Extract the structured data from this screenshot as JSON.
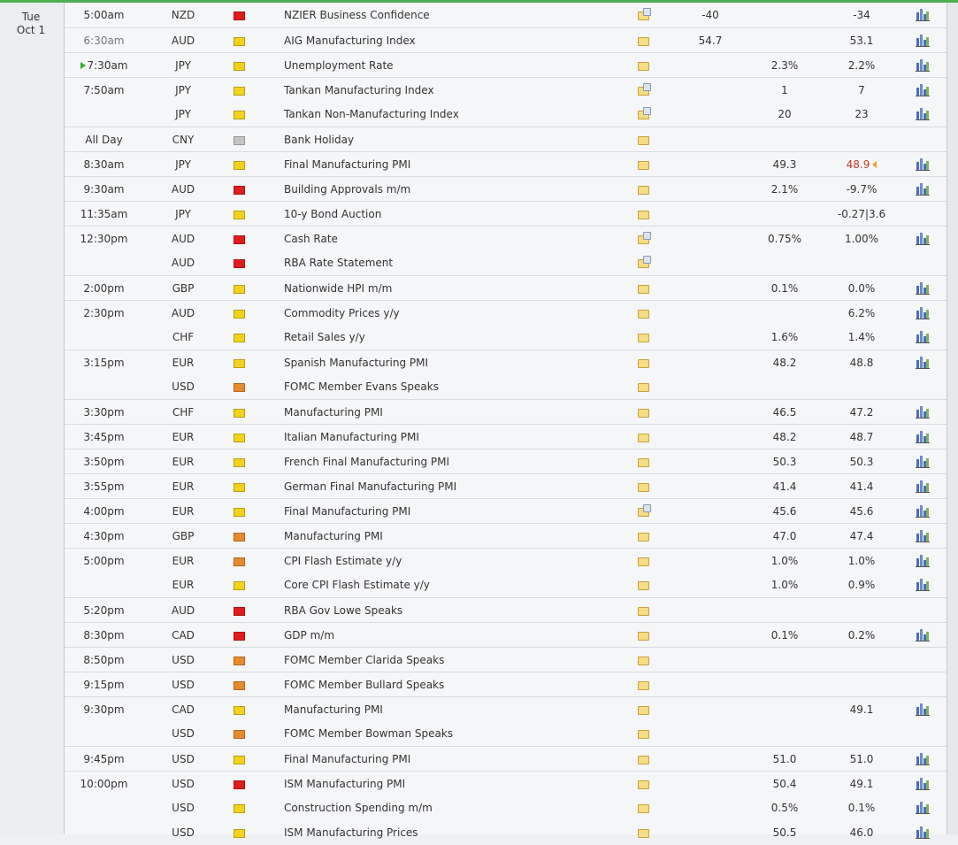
{
  "day": {
    "weekday": "Tue",
    "date": "Oct 1"
  },
  "accent_colors": {
    "high": "#e21b1b",
    "medium": "#e88a2c",
    "low": "#f4d21c",
    "holiday": "#c4c4c4",
    "revised": "#c0392b",
    "top_bar": "#4caf50"
  },
  "events": [
    {
      "time": "5:00am",
      "currency": "NZD",
      "impact": "high",
      "event": "NZIER Business Confidence",
      "detail_icon": "doc",
      "actual": "-40",
      "forecast": "",
      "previous": "-34",
      "chart": true
    },
    {
      "time": "6:30am",
      "currency": "AUD",
      "impact": "low",
      "event": "AIG Manufacturing Index",
      "detail_icon": "folder",
      "actual": "54.7",
      "forecast": "",
      "previous": "53.1",
      "chart": true
    },
    {
      "time": "7:30am",
      "currency": "JPY",
      "impact": "low",
      "event": "Unemployment Rate",
      "detail_icon": "folder",
      "actual": "",
      "forecast": "2.3%",
      "previous": "2.2%",
      "chart": true,
      "live": true
    },
    {
      "time": "7:50am",
      "currency": "JPY",
      "impact": "low",
      "event": "Tankan Manufacturing Index",
      "detail_icon": "doc",
      "actual": "",
      "forecast": "1",
      "previous": "7",
      "chart": true
    },
    {
      "time": "",
      "currency": "JPY",
      "impact": "low",
      "event": "Tankan Non-Manufacturing Index",
      "detail_icon": "doc",
      "actual": "",
      "forecast": "20",
      "previous": "23",
      "chart": true
    },
    {
      "time": "All Day",
      "currency": "CNY",
      "impact": "none",
      "event": "Bank Holiday",
      "detail_icon": "folder",
      "actual": "",
      "forecast": "",
      "previous": "",
      "chart": false
    },
    {
      "time": "8:30am",
      "currency": "JPY",
      "impact": "low",
      "event": "Final Manufacturing PMI",
      "detail_icon": "folder",
      "actual": "",
      "forecast": "49.3",
      "previous": "48.9",
      "chart": true,
      "revised": true
    },
    {
      "time": "9:30am",
      "currency": "AUD",
      "impact": "high",
      "event": "Building Approvals m/m",
      "detail_icon": "folder",
      "actual": "",
      "forecast": "2.1%",
      "previous": "-9.7%",
      "chart": true
    },
    {
      "time": "11:35am",
      "currency": "JPY",
      "impact": "low",
      "event": "10-y Bond Auction",
      "detail_icon": "folder",
      "actual": "",
      "forecast": "",
      "previous": "-0.27|3.6",
      "chart": false
    },
    {
      "time": "12:30pm",
      "currency": "AUD",
      "impact": "high",
      "event": "Cash Rate",
      "detail_icon": "doc",
      "actual": "",
      "forecast": "0.75%",
      "previous": "1.00%",
      "chart": true
    },
    {
      "time": "",
      "currency": "AUD",
      "impact": "high",
      "event": "RBA Rate Statement",
      "detail_icon": "doc",
      "actual": "",
      "forecast": "",
      "previous": "",
      "chart": false
    },
    {
      "time": "2:00pm",
      "currency": "GBP",
      "impact": "low",
      "event": "Nationwide HPI m/m",
      "detail_icon": "folder",
      "actual": "",
      "forecast": "0.1%",
      "previous": "0.0%",
      "chart": true
    },
    {
      "time": "2:30pm",
      "currency": "AUD",
      "impact": "low",
      "event": "Commodity Prices y/y",
      "detail_icon": "folder",
      "actual": "",
      "forecast": "",
      "previous": "6.2%",
      "chart": true
    },
    {
      "time": "",
      "currency": "CHF",
      "impact": "low",
      "event": "Retail Sales y/y",
      "detail_icon": "folder",
      "actual": "",
      "forecast": "1.6%",
      "previous": "1.4%",
      "chart": true
    },
    {
      "time": "3:15pm",
      "currency": "EUR",
      "impact": "low",
      "event": "Spanish Manufacturing PMI",
      "detail_icon": "folder",
      "actual": "",
      "forecast": "48.2",
      "previous": "48.8",
      "chart": true
    },
    {
      "time": "",
      "currency": "USD",
      "impact": "medium",
      "event": "FOMC Member Evans Speaks",
      "detail_icon": "folder",
      "actual": "",
      "forecast": "",
      "previous": "",
      "chart": false
    },
    {
      "time": "3:30pm",
      "currency": "CHF",
      "impact": "low",
      "event": "Manufacturing PMI",
      "detail_icon": "folder",
      "actual": "",
      "forecast": "46.5",
      "previous": "47.2",
      "chart": true
    },
    {
      "time": "3:45pm",
      "currency": "EUR",
      "impact": "low",
      "event": "Italian Manufacturing PMI",
      "detail_icon": "folder",
      "actual": "",
      "forecast": "48.2",
      "previous": "48.7",
      "chart": true
    },
    {
      "time": "3:50pm",
      "currency": "EUR",
      "impact": "low",
      "event": "French Final Manufacturing PMI",
      "detail_icon": "folder",
      "actual": "",
      "forecast": "50.3",
      "previous": "50.3",
      "chart": true
    },
    {
      "time": "3:55pm",
      "currency": "EUR",
      "impact": "low",
      "event": "German Final Manufacturing PMI",
      "detail_icon": "folder",
      "actual": "",
      "forecast": "41.4",
      "previous": "41.4",
      "chart": true
    },
    {
      "time": "4:00pm",
      "currency": "EUR",
      "impact": "low",
      "event": "Final Manufacturing PMI",
      "detail_icon": "doc",
      "actual": "",
      "forecast": "45.6",
      "previous": "45.6",
      "chart": true
    },
    {
      "time": "4:30pm",
      "currency": "GBP",
      "impact": "medium",
      "event": "Manufacturing PMI",
      "detail_icon": "folder",
      "actual": "",
      "forecast": "47.0",
      "previous": "47.4",
      "chart": true
    },
    {
      "time": "5:00pm",
      "currency": "EUR",
      "impact": "medium",
      "event": "CPI Flash Estimate y/y",
      "detail_icon": "folder",
      "actual": "",
      "forecast": "1.0%",
      "previous": "1.0%",
      "chart": true
    },
    {
      "time": "",
      "currency": "EUR",
      "impact": "low",
      "event": "Core CPI Flash Estimate y/y",
      "detail_icon": "folder",
      "actual": "",
      "forecast": "1.0%",
      "previous": "0.9%",
      "chart": true
    },
    {
      "time": "5:20pm",
      "currency": "AUD",
      "impact": "high",
      "event": "RBA Gov Lowe Speaks",
      "detail_icon": "folder",
      "actual": "",
      "forecast": "",
      "previous": "",
      "chart": false
    },
    {
      "time": "8:30pm",
      "currency": "CAD",
      "impact": "high",
      "event": "GDP m/m",
      "detail_icon": "folder",
      "actual": "",
      "forecast": "0.1%",
      "previous": "0.2%",
      "chart": true
    },
    {
      "time": "8:50pm",
      "currency": "USD",
      "impact": "medium",
      "event": "FOMC Member Clarida Speaks",
      "detail_icon": "folder",
      "actual": "",
      "forecast": "",
      "previous": "",
      "chart": false
    },
    {
      "time": "9:15pm",
      "currency": "USD",
      "impact": "medium",
      "event": "FOMC Member Bullard Speaks",
      "detail_icon": "folder",
      "actual": "",
      "forecast": "",
      "previous": "",
      "chart": false
    },
    {
      "time": "9:30pm",
      "currency": "CAD",
      "impact": "low",
      "event": "Manufacturing PMI",
      "detail_icon": "folder",
      "actual": "",
      "forecast": "",
      "previous": "49.1",
      "chart": true
    },
    {
      "time": "",
      "currency": "USD",
      "impact": "medium",
      "event": "FOMC Member Bowman Speaks",
      "detail_icon": "folder",
      "actual": "",
      "forecast": "",
      "previous": "",
      "chart": false
    },
    {
      "time": "9:45pm",
      "currency": "USD",
      "impact": "low",
      "event": "Final Manufacturing PMI",
      "detail_icon": "folder",
      "actual": "",
      "forecast": "51.0",
      "previous": "51.0",
      "chart": true
    },
    {
      "time": "10:00pm",
      "currency": "USD",
      "impact": "high",
      "event": "ISM Manufacturing PMI",
      "detail_icon": "folder",
      "actual": "",
      "forecast": "50.4",
      "previous": "49.1",
      "chart": true
    },
    {
      "time": "",
      "currency": "USD",
      "impact": "low",
      "event": "Construction Spending m/m",
      "detail_icon": "folder",
      "actual": "",
      "forecast": "0.5%",
      "previous": "0.1%",
      "chart": true
    },
    {
      "time": "",
      "currency": "USD",
      "impact": "low",
      "event": "ISM Manufacturing Prices",
      "detail_icon": "folder",
      "actual": "",
      "forecast": "50.5",
      "previous": "46.0",
      "chart": true
    }
  ]
}
